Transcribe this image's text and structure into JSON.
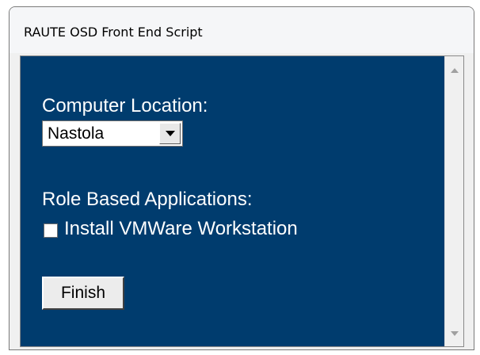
{
  "window": {
    "title": "RAUTE OSD Front End Script"
  },
  "form": {
    "location_label": "Computer Location:",
    "location_select": {
      "selected": "Nastola"
    },
    "role_label": "Role Based Applications:",
    "vmware_checkbox": {
      "label": "Install VMWare Workstation",
      "checked": false
    },
    "finish_label": "Finish"
  },
  "colors": {
    "content_background": "#003c6e",
    "text": "#ffffff"
  },
  "icons": {
    "dropdown": "chevron-down-icon",
    "scroll_up": "scroll-up-arrow-icon",
    "scroll_down": "scroll-down-arrow-icon"
  }
}
